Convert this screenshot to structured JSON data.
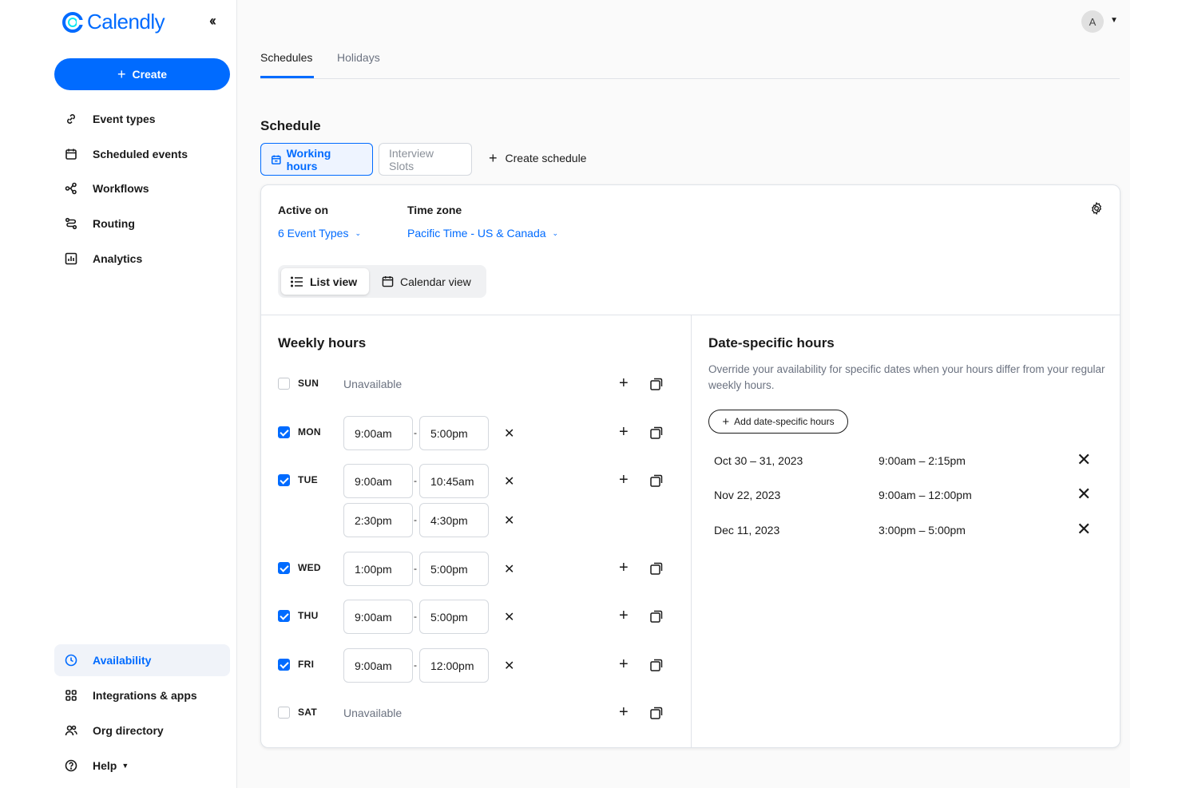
{
  "brand": {
    "name": "Calendly",
    "accent": "#006bff"
  },
  "sidebar": {
    "collapse_icon": "double-chevron-left-icon",
    "create_label": "Create",
    "items_top": [
      {
        "label": "Event types",
        "icon": "link-icon"
      },
      {
        "label": "Scheduled events",
        "icon": "calendar-icon"
      },
      {
        "label": "Workflows",
        "icon": "workflow-icon"
      },
      {
        "label": "Routing",
        "icon": "routing-icon"
      },
      {
        "label": "Analytics",
        "icon": "chart-icon"
      }
    ],
    "items_bottom": [
      {
        "label": "Availability",
        "icon": "clock-icon",
        "active": true
      },
      {
        "label": "Integrations & apps",
        "icon": "grid-icon"
      },
      {
        "label": "Org directory",
        "icon": "people-icon"
      },
      {
        "label": "Help",
        "icon": "question-icon"
      }
    ]
  },
  "header": {
    "avatar_initial": "A"
  },
  "tabs": [
    {
      "label": "Schedules",
      "active": true
    },
    {
      "label": "Holidays",
      "active": false
    }
  ],
  "schedule": {
    "title": "Schedule",
    "pills": [
      {
        "label": "Working hours",
        "active": true
      },
      {
        "label": "Interview Slots",
        "active": false
      }
    ],
    "create_label": "Create schedule",
    "active_on_label": "Active on",
    "active_on_value": "6 Event Types",
    "timezone_label": "Time zone",
    "timezone_value": "Pacific Time - US & Canada",
    "list_view_label": "List view",
    "calendar_view_label": "Calendar view"
  },
  "weekly": {
    "title": "Weekly hours",
    "unavailable_label": "Unavailable",
    "days": [
      {
        "day": "SUN",
        "checked": false,
        "ranges": []
      },
      {
        "day": "MON",
        "checked": true,
        "ranges": [
          [
            "9:00am",
            "5:00pm"
          ]
        ]
      },
      {
        "day": "TUE",
        "checked": true,
        "ranges": [
          [
            "9:00am",
            "10:45am"
          ],
          [
            "2:30pm",
            "4:30pm"
          ]
        ]
      },
      {
        "day": "WED",
        "checked": true,
        "ranges": [
          [
            "1:00pm",
            "5:00pm"
          ]
        ]
      },
      {
        "day": "THU",
        "checked": true,
        "ranges": [
          [
            "9:00am",
            "5:00pm"
          ]
        ]
      },
      {
        "day": "FRI",
        "checked": true,
        "ranges": [
          [
            "9:00am",
            "12:00pm"
          ]
        ]
      },
      {
        "day": "SAT",
        "checked": false,
        "ranges": []
      }
    ]
  },
  "date_specific": {
    "title": "Date-specific hours",
    "description": "Override your availability for specific dates when your hours differ from your regular weekly hours.",
    "add_label": "Add date-specific hours",
    "entries": [
      {
        "date": "Oct 30 – 31, 2023",
        "time": "9:00am – 2:15pm"
      },
      {
        "date": "Nov 22, 2023",
        "time": "9:00am – 12:00pm"
      },
      {
        "date": "Dec 11, 2023",
        "time": "3:00pm – 5:00pm"
      }
    ]
  }
}
